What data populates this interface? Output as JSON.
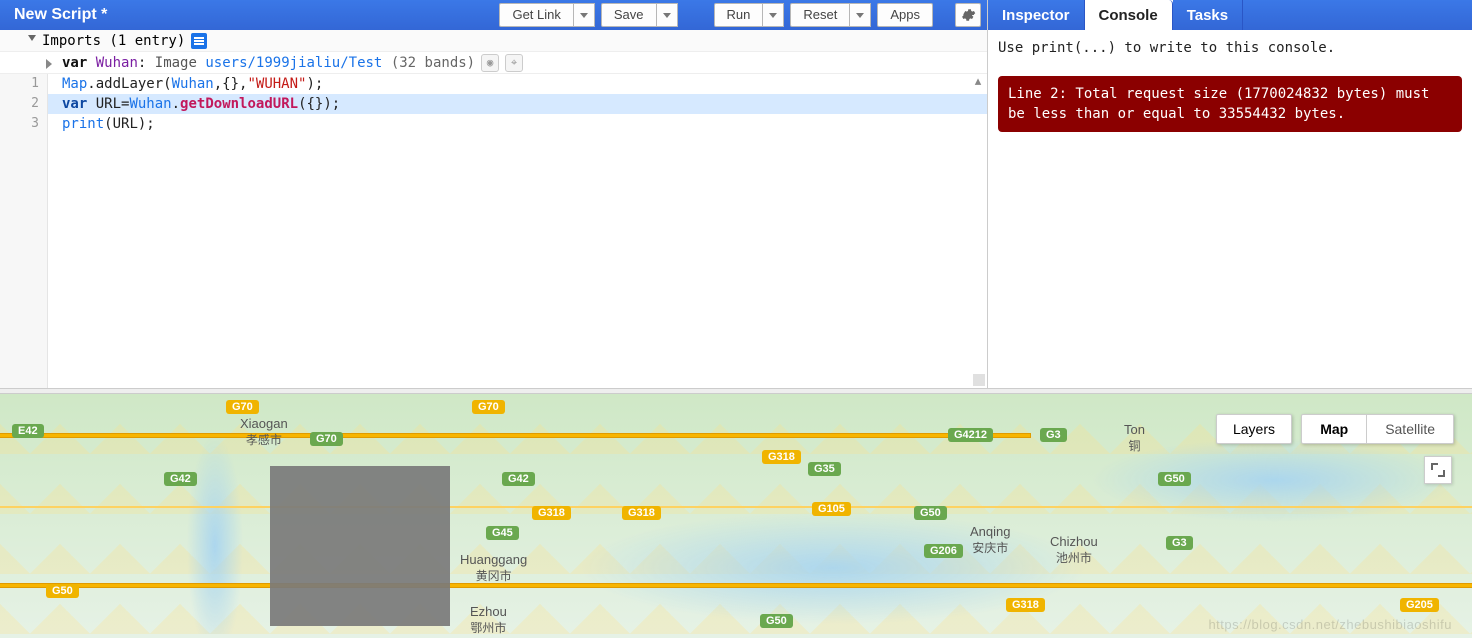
{
  "editor": {
    "title": "New Script *",
    "buttons": {
      "get_link": "Get Link",
      "save": "Save",
      "run": "Run",
      "reset": "Reset",
      "apps": "Apps"
    },
    "imports": {
      "header": "Imports (1 entry)",
      "entry": {
        "kw": "var",
        "name": "Wuhan",
        "colon": ":",
        "type": "Image",
        "path": "users/1999jialiu/Test",
        "note": "(32 bands)"
      }
    },
    "gutter": [
      "1",
      "2",
      "3"
    ],
    "code": {
      "l1": {
        "a": "Map",
        "b": ".addLayer(",
        "c": "Wuhan",
        "d": ",{},",
        "e": "\"WUHAN\"",
        "f": ");"
      },
      "l2": {
        "a": "var",
        "b": " URL=",
        "c": "Wuhan",
        "d": ".",
        "e": "getDownloadURL",
        "f": "({});"
      },
      "l3": {
        "a": "print",
        "b": "(URL);"
      }
    }
  },
  "console": {
    "tabs": {
      "inspector": "Inspector",
      "console": "Console",
      "tasks": "Tasks"
    },
    "hint": "Use print(...) to write to this console.",
    "error": "Line 2: Total request size (1770024832 bytes) must be less than or equal to 33554432 bytes."
  },
  "map": {
    "layers_btn": "Layers",
    "view_map": "Map",
    "view_sat": "Satellite",
    "cities": {
      "xiaogan_en": "Xiaogan",
      "xiaogan_cn": "孝感市",
      "huanggang_en": "Huanggang",
      "huanggang_cn": "黄冈市",
      "ezhou_en": "Ezhou",
      "ezhou_cn": "鄂州市",
      "anqing_en": "Anqing",
      "anqing_cn": "安庆市",
      "chizhou_en": "Chizhou",
      "chizhou_cn": "池州市",
      "tong_en": "Ton",
      "tong_cn": "铜"
    },
    "shields": {
      "a": "G70",
      "b": "G70",
      "c": "G70",
      "d": "E42",
      "e": "G42",
      "f": "G42",
      "g": "G50",
      "h": "G50",
      "i": "G318",
      "j": "G318",
      "k": "G318",
      "l": "G318",
      "m": "G35",
      "n": "G105",
      "o": "G45",
      "p": "G50",
      "q": "G4212",
      "r": "G3",
      "s": "G3",
      "t": "G206",
      "u": "G205",
      "v": "G50"
    },
    "watermark": "https://blog.csdn.net/zhebushibiaoshifu"
  }
}
